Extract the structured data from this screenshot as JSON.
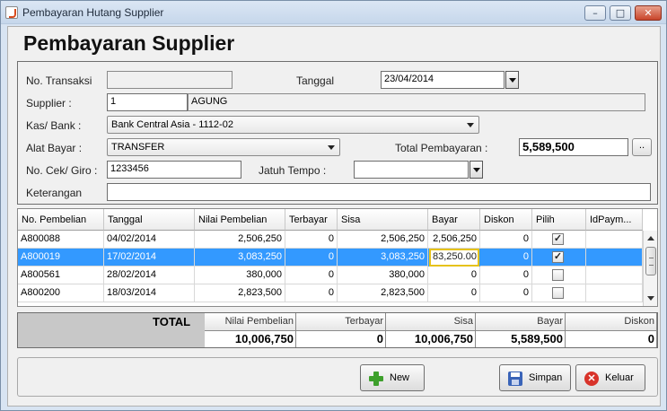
{
  "window": {
    "title": "Pembayaran Hutang Supplier",
    "controls": {
      "minimize": "–",
      "maximize": "□",
      "close": "✕"
    }
  },
  "heading": "Pembayaran Supplier",
  "form": {
    "no_transaksi_label": "No. Transaksi",
    "no_transaksi_value": "",
    "tanggal_label": "Tanggal",
    "tanggal_value": "23/04/2014",
    "supplier_label": "Supplier :",
    "supplier_code": "1",
    "supplier_name": "AGUNG",
    "kas_bank_label": "Kas/ Bank :",
    "kas_bank_value": "Bank Central Asia - 1112-02",
    "alat_bayar_label": "Alat Bayar :",
    "alat_bayar_value": "TRANSFER",
    "total_pembayaran_label": "Total Pembayaran :",
    "total_pembayaran_value": "5,589,500",
    "lookup_button": "..",
    "no_cek_label": "No. Cek/ Giro :",
    "no_cek_value": "1233456",
    "jatuh_tempo_label": "Jatuh Tempo :",
    "jatuh_tempo_value": "",
    "keterangan_label": "Keterangan",
    "keterangan_value": ""
  },
  "table": {
    "columns": [
      "No. Pembelian",
      "Tanggal",
      "Nilai Pembelian",
      "Terbayar",
      "Sisa",
      "Bayar",
      "Diskon",
      "Pilih",
      "IdPaym..."
    ],
    "rows": [
      {
        "no": "A800088",
        "tanggal": "04/02/2014",
        "nilai": "2,506,250",
        "terbayar": "0",
        "sisa": "2,506,250",
        "bayar": "2,506,250",
        "diskon": "0",
        "pilih": true,
        "selected": false
      },
      {
        "no": "A800019",
        "tanggal": "17/02/2014",
        "nilai": "3,083,250",
        "terbayar": "0",
        "sisa": "3,083,250",
        "bayar": "83,250.00",
        "diskon": "0",
        "pilih": true,
        "selected": true
      },
      {
        "no": "A800561",
        "tanggal": "28/02/2014",
        "nilai": "380,000",
        "terbayar": "0",
        "sisa": "380,000",
        "bayar": "0",
        "diskon": "0",
        "pilih": false,
        "selected": false
      },
      {
        "no": "A800200",
        "tanggal": "18/03/2014",
        "nilai": "2,823,500",
        "terbayar": "0",
        "sisa": "2,823,500",
        "bayar": "0",
        "diskon": "0",
        "pilih": false,
        "selected": false
      }
    ]
  },
  "totals": {
    "label": "TOTAL",
    "headers": [
      "Nilai Pembelian",
      "Terbayar",
      "Sisa",
      "Bayar",
      "Diskon"
    ],
    "values": [
      "10,006,750",
      "0",
      "10,006,750",
      "5,589,500",
      "0"
    ]
  },
  "buttons": {
    "new": "New",
    "save": "Simpan",
    "exit": "Keluar",
    "cancel_glyph": "✕"
  },
  "colors": {
    "selection": "#3399ff",
    "edit_border": "#e6c21a",
    "add_icon": "#3ea02c",
    "close_icon": "#d8332a"
  }
}
